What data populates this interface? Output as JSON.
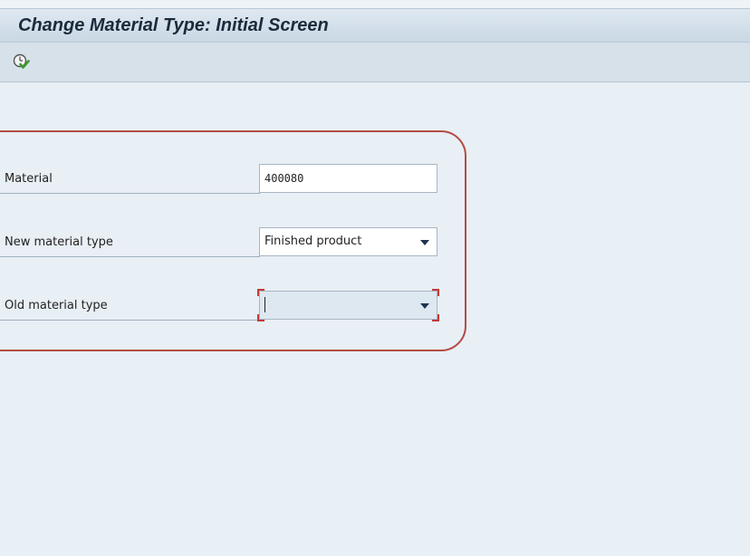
{
  "window": {
    "title": "Change Material Type: Initial Screen"
  },
  "toolbar": {
    "execute_icon": "execute-clock-check-icon"
  },
  "form": {
    "material": {
      "label": "Material",
      "value": "400080"
    },
    "new_material_type": {
      "label": "New material type",
      "value": "Finished product"
    },
    "old_material_type": {
      "label": "Old material type",
      "value": ""
    }
  },
  "colors": {
    "highlight": "#b34d45",
    "focus_corners": "#c23a3a"
  }
}
